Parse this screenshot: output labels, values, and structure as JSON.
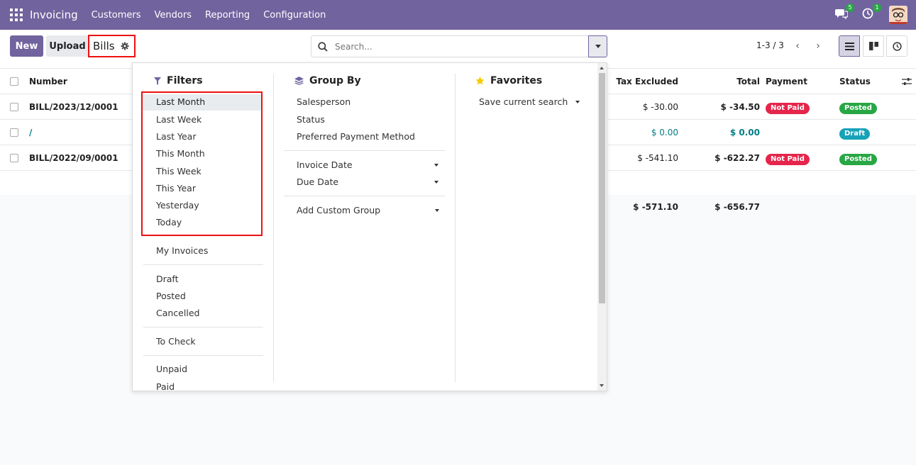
{
  "navbar": {
    "app_name": "Invoicing",
    "menu": [
      "Customers",
      "Vendors",
      "Reporting",
      "Configuration"
    ],
    "messages_count": "5",
    "activities_count": "1"
  },
  "control": {
    "new_label": "New",
    "upload_label": "Upload",
    "breadcrumb": "Bills",
    "search_placeholder": "Search...",
    "pager": "1-3 / 3"
  },
  "list": {
    "headers": {
      "number": "Number",
      "tax_excluded": "Tax Excluded",
      "total": "Total",
      "payment": "Payment",
      "status": "Status"
    },
    "rows": [
      {
        "number": "BILL/2023/12/0001",
        "tax_excluded": "$ -30.00",
        "total": "$ -34.50",
        "payment": "Not Paid",
        "status": "Posted"
      },
      {
        "number": "/",
        "tax_excluded": "$ 0.00",
        "total": "$ 0.00",
        "payment": "",
        "status": "Draft"
      },
      {
        "number": "BILL/2022/09/0001",
        "tax_excluded": "$ -541.10",
        "total": "$ -622.27",
        "payment": "Not Paid",
        "status": "Posted"
      }
    ],
    "totals": {
      "tax_excluded": "$ -571.10",
      "total": "$ -656.77"
    }
  },
  "dropdown": {
    "filters_title": "Filters",
    "filters_date": [
      "Last Month",
      "Last Week",
      "Last Year",
      "This Month",
      "This Week",
      "This Year",
      "Yesterday",
      "Today"
    ],
    "filters_other": [
      "My Invoices",
      "Draft",
      "Posted",
      "Cancelled",
      "To Check",
      "Unpaid",
      "Paid"
    ],
    "groupby_title": "Group By",
    "groupby_items": [
      "Salesperson",
      "Status",
      "Preferred Payment Method",
      "Invoice Date",
      "Due Date",
      "Add Custom Group"
    ],
    "favorites_title": "Favorites",
    "favorites_save": "Save current search"
  },
  "colors": {
    "brand": "#71639e",
    "highlight": "#ee1111",
    "paid_red": "#e5254b",
    "posted_green": "#28a745",
    "draft_teal": "#17a2b8"
  }
}
